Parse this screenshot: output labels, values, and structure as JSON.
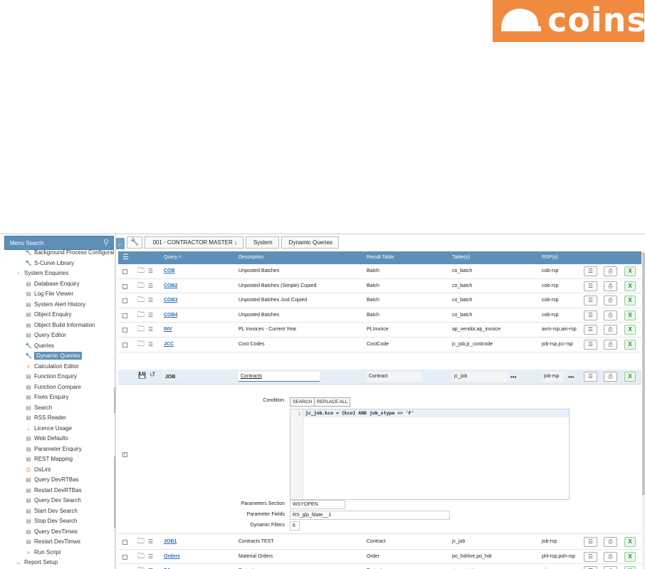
{
  "brand": {
    "logo_text": "coins",
    "color": "#f08a3e"
  },
  "sidebar": {
    "search_label": "Menu Search",
    "items": [
      {
        "label": "Background Process Configurat",
        "icon": "wrench-icon"
      },
      {
        "label": "S-Curve Library",
        "icon": "wrench-icon"
      },
      {
        "label": "System Enquiries",
        "icon": "chevron-right-icon"
      },
      {
        "label": "Database Enquiry",
        "icon": "report-icon"
      },
      {
        "label": "Log File Viewer",
        "icon": "report-icon"
      },
      {
        "label": "System Alert History",
        "icon": "report-icon"
      },
      {
        "label": "Object Enquiry",
        "icon": "report-icon"
      },
      {
        "label": "Object Build Information",
        "icon": "report-icon"
      },
      {
        "label": "Query Editor",
        "icon": "report-icon"
      },
      {
        "label": "Queries",
        "icon": "wrench-icon"
      },
      {
        "label": "Dynamic Queries",
        "icon": "wrench-icon"
      },
      {
        "label": "Calculation Editor",
        "icon": "chevrons-icon"
      },
      {
        "label": "Function Enquiry",
        "icon": "report-icon"
      },
      {
        "label": "Function Compare",
        "icon": "report-icon"
      },
      {
        "label": "Fixes Enquiry",
        "icon": "report-icon"
      },
      {
        "label": "Search",
        "icon": "report-icon"
      },
      {
        "label": "RSS Reader",
        "icon": "report-icon"
      },
      {
        "label": "Licence Usage",
        "icon": "chevron-down-icon"
      },
      {
        "label": "Web Defaults",
        "icon": "report-icon"
      },
      {
        "label": "Parameter Enquiry",
        "icon": "report-icon"
      },
      {
        "label": "REST Mapping",
        "icon": "report-icon"
      },
      {
        "label": "OsLint",
        "icon": "printer-icon"
      },
      {
        "label": "Query DevRTBas",
        "icon": "report-icon"
      },
      {
        "label": "Restart DevRTBas",
        "icon": "report-icon"
      },
      {
        "label": "Query Dev Search",
        "icon": "report-icon"
      },
      {
        "label": "Start Dev Search",
        "icon": "report-icon"
      },
      {
        "label": "Stop Dev Search",
        "icon": "report-icon"
      },
      {
        "label": "Query DevTimws",
        "icon": "report-icon"
      },
      {
        "label": "Restart DevTimws",
        "icon": "report-icon"
      },
      {
        "label": "Run Script",
        "icon": "chevrons-icon"
      },
      {
        "label": "Report Setup",
        "icon": "chevron-down-icon"
      }
    ]
  },
  "breadcrumb": [
    "001 - CONTRACTOR MASTER",
    "System",
    "Dynamic Queries"
  ],
  "table": {
    "headers": {
      "query": "Query",
      "description": "Description",
      "result_table": "Result Table",
      "tables": "Table(s)",
      "rsp": "RSP(s)"
    },
    "rows_top": [
      {
        "query": "COB",
        "description": "Unposted Batches",
        "result": "Batch",
        "tables": "co_batch",
        "rsp": "cob-rsp"
      },
      {
        "query": "COB2",
        "description": "Unposted Batches (Simple) Copied",
        "result": "Batch",
        "tables": "co_batch",
        "rsp": "cob-rsp"
      },
      {
        "query": "COB3",
        "description": "Unposted Batches Just Copied",
        "result": "Batch",
        "tables": "co_batch",
        "rsp": "cob-rsp"
      },
      {
        "query": "COB4",
        "description": "Unposted Batches",
        "result": "Batch",
        "tables": "co_batch",
        "rsp": "cob-rsp"
      },
      {
        "query": "INV",
        "description": "PL Invoices - Current Year",
        "result": "PLInvoice",
        "tables": "ap_vendor,ap_invoice",
        "rsp": "avm-rsp,ain-rsp"
      },
      {
        "query": "JCC",
        "description": "Cost Codes",
        "result": "CostCode",
        "tables": "jc_job,jc_costcode",
        "rsp": "job-rsp,jcc-rsp"
      }
    ],
    "edit_row": {
      "query": "JOB",
      "description": "Contracts",
      "result": "Contract",
      "tables": "jc_job",
      "rsp": "job-rsp",
      "more": "•••"
    },
    "detail": {
      "condition_label": "Condition",
      "search_btn": "SEARCH",
      "replace_btn": "REPLACE ALL",
      "line_no": "1",
      "code": "jc_job.kco = {kco} AND job_stype <> 'F'",
      "params_section_label": "Parameters Section",
      "params_section_value": "WSYOPEN",
      "param_fields_label": "Parameter Fields",
      "param_fields_value": "RS_glp_fdate__1",
      "dynamic_filters_label": "Dynamic Filters",
      "dynamic_filters_value": "6"
    },
    "rows_bottom": [
      {
        "query": "JOB1",
        "description": "Contracts TEST",
        "result": "Contract",
        "tables": "jc_job",
        "rsp": "job-rsp"
      },
      {
        "query": "Orders",
        "description": "Material Orders",
        "result": "Order",
        "tables": "po_hdrlive,po_hdr",
        "rsp": "phl-rsp,poh-rsp"
      },
      {
        "query": "PJ",
        "description": "Projects",
        "result": "Project",
        "tables": "pj_project",
        "rsp": "pij-rsp"
      }
    ]
  }
}
